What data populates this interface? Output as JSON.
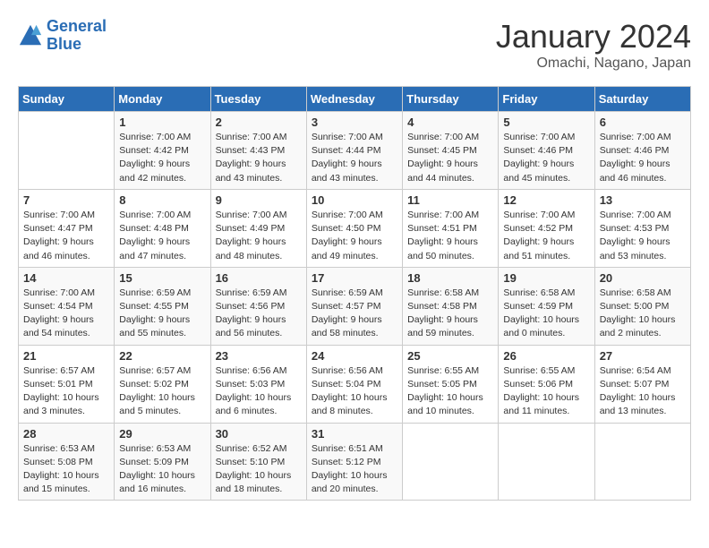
{
  "header": {
    "logo_line1": "General",
    "logo_line2": "Blue",
    "month_title": "January 2024",
    "location": "Omachi, Nagano, Japan"
  },
  "weekdays": [
    "Sunday",
    "Monday",
    "Tuesday",
    "Wednesday",
    "Thursday",
    "Friday",
    "Saturday"
  ],
  "weeks": [
    [
      {
        "day": "",
        "info": ""
      },
      {
        "day": "1",
        "info": "Sunrise: 7:00 AM\nSunset: 4:42 PM\nDaylight: 9 hours\nand 42 minutes."
      },
      {
        "day": "2",
        "info": "Sunrise: 7:00 AM\nSunset: 4:43 PM\nDaylight: 9 hours\nand 43 minutes."
      },
      {
        "day": "3",
        "info": "Sunrise: 7:00 AM\nSunset: 4:44 PM\nDaylight: 9 hours\nand 43 minutes."
      },
      {
        "day": "4",
        "info": "Sunrise: 7:00 AM\nSunset: 4:45 PM\nDaylight: 9 hours\nand 44 minutes."
      },
      {
        "day": "5",
        "info": "Sunrise: 7:00 AM\nSunset: 4:46 PM\nDaylight: 9 hours\nand 45 minutes."
      },
      {
        "day": "6",
        "info": "Sunrise: 7:00 AM\nSunset: 4:46 PM\nDaylight: 9 hours\nand 46 minutes."
      }
    ],
    [
      {
        "day": "7",
        "info": ""
      },
      {
        "day": "8",
        "info": "Sunrise: 7:00 AM\nSunset: 4:48 PM\nDaylight: 9 hours\nand 47 minutes."
      },
      {
        "day": "9",
        "info": "Sunrise: 7:00 AM\nSunset: 4:49 PM\nDaylight: 9 hours\nand 48 minutes."
      },
      {
        "day": "10",
        "info": "Sunrise: 7:00 AM\nSunset: 4:50 PM\nDaylight: 9 hours\nand 49 minutes."
      },
      {
        "day": "11",
        "info": "Sunrise: 7:00 AM\nSunset: 4:51 PM\nDaylight: 9 hours\nand 50 minutes."
      },
      {
        "day": "12",
        "info": "Sunrise: 7:00 AM\nSunset: 4:52 PM\nDaylight: 9 hours\nand 51 minutes."
      },
      {
        "day": "13",
        "info": "Sunrise: 7:00 AM\nSunset: 4:53 PM\nDaylight: 9 hours\nand 53 minutes."
      }
    ],
    [
      {
        "day": "14",
        "info": ""
      },
      {
        "day": "15",
        "info": "Sunrise: 6:59 AM\nSunset: 4:55 PM\nDaylight: 9 hours\nand 55 minutes."
      },
      {
        "day": "16",
        "info": "Sunrise: 6:59 AM\nSunset: 4:56 PM\nDaylight: 9 hours\nand 56 minutes."
      },
      {
        "day": "17",
        "info": "Sunrise: 6:59 AM\nSunset: 4:57 PM\nDaylight: 9 hours\nand 58 minutes."
      },
      {
        "day": "18",
        "info": "Sunrise: 6:58 AM\nSunset: 4:58 PM\nDaylight: 9 hours\nand 59 minutes."
      },
      {
        "day": "19",
        "info": "Sunrise: 6:58 AM\nSunset: 4:59 PM\nDaylight: 10 hours\nand 0 minutes."
      },
      {
        "day": "20",
        "info": "Sunrise: 6:58 AM\nSunset: 5:00 PM\nDaylight: 10 hours\nand 2 minutes."
      }
    ],
    [
      {
        "day": "21",
        "info": ""
      },
      {
        "day": "22",
        "info": "Sunrise: 6:57 AM\nSunset: 5:02 PM\nDaylight: 10 hours\nand 5 minutes."
      },
      {
        "day": "23",
        "info": "Sunrise: 6:56 AM\nSunset: 5:03 PM\nDaylight: 10 hours\nand 6 minutes."
      },
      {
        "day": "24",
        "info": "Sunrise: 6:56 AM\nSunset: 5:04 PM\nDaylight: 10 hours\nand 8 minutes."
      },
      {
        "day": "25",
        "info": "Sunrise: 6:55 AM\nSunset: 5:05 PM\nDaylight: 10 hours\nand 10 minutes."
      },
      {
        "day": "26",
        "info": "Sunrise: 6:55 AM\nSunset: 5:06 PM\nDaylight: 10 hours\nand 11 minutes."
      },
      {
        "day": "27",
        "info": "Sunrise: 6:54 AM\nSunset: 5:07 PM\nDaylight: 10 hours\nand 13 minutes."
      }
    ],
    [
      {
        "day": "28",
        "info": ""
      },
      {
        "day": "29",
        "info": "Sunrise: 6:53 AM\nSunset: 5:09 PM\nDaylight: 10 hours\nand 16 minutes."
      },
      {
        "day": "30",
        "info": "Sunrise: 6:52 AM\nSunset: 5:10 PM\nDaylight: 10 hours\nand 18 minutes."
      },
      {
        "day": "31",
        "info": "Sunrise: 6:51 AM\nSunset: 5:12 PM\nDaylight: 10 hours\nand 20 minutes."
      },
      {
        "day": "",
        "info": ""
      },
      {
        "day": "",
        "info": ""
      },
      {
        "day": "",
        "info": ""
      }
    ]
  ],
  "week1_day7_info": "Sunrise: 7:00 AM\nSunset: 4:47 PM\nDaylight: 9 hours\nand 46 minutes.",
  "week3_day14_info": "Sunrise: 7:00 AM\nSunset: 4:54 PM\nDaylight: 9 hours\nand 54 minutes.",
  "week4_day21_info": "Sunrise: 6:57 AM\nSunset: 5:01 PM\nDaylight: 10 hours\nand 3 minutes.",
  "week5_day28_info": "Sunrise: 6:53 AM\nSunset: 5:08 PM\nDaylight: 10 hours\nand 15 minutes."
}
